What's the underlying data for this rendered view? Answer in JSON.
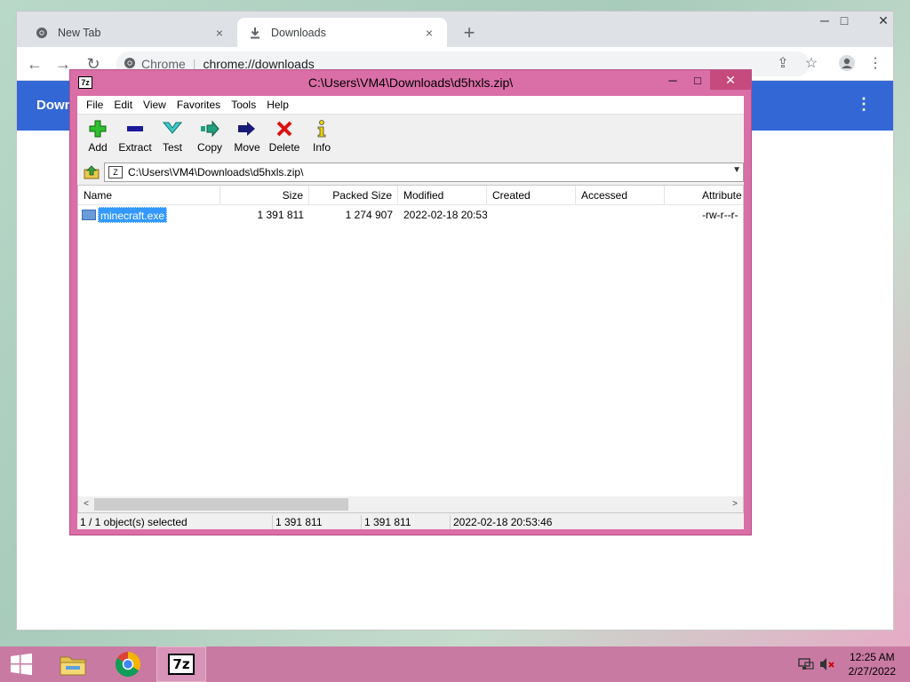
{
  "chrome": {
    "tabs": [
      {
        "label": "New Tab",
        "icon": "chrome-icon",
        "close": "×"
      },
      {
        "label": "Downloads",
        "icon": "download-icon",
        "close": "×"
      }
    ],
    "new_tab": "+",
    "window_controls": {
      "minimize": "─",
      "maximize": "□",
      "close": "✕"
    },
    "omnibox": {
      "origin": "Chrome",
      "separator": "|",
      "url": "chrome://downloads"
    },
    "page": {
      "title": "Down",
      "menu": "⋮"
    }
  },
  "zip": {
    "title": "C:\\Users\\VM4\\Downloads\\d5hxls.zip\\",
    "app_icon": "7z",
    "controls": {
      "minimize": "─",
      "maximize": "□",
      "close": "✕"
    },
    "menu": [
      "File",
      "Edit",
      "View",
      "Favorites",
      "Tools",
      "Help"
    ],
    "toolbar": [
      {
        "label": "Add",
        "icon": "add-icon",
        "color": "#22aa22"
      },
      {
        "label": "Extract",
        "icon": "extract-icon",
        "color": "#1a1a9a"
      },
      {
        "label": "Test",
        "icon": "test-icon",
        "color": "#20b0b0"
      },
      {
        "label": "Copy",
        "icon": "copy-icon",
        "color": "#189070"
      },
      {
        "label": "Move",
        "icon": "move-icon",
        "color": "#1a1a7a"
      },
      {
        "label": "Delete",
        "icon": "delete-icon",
        "color": "#dd1111"
      },
      {
        "label": "Info",
        "icon": "info-icon",
        "color": "#d8c400"
      }
    ],
    "address": "C:\\Users\\VM4\\Downloads\\d5hxls.zip\\",
    "address_icon": "Z",
    "columns": [
      "Name",
      "Size",
      "Packed Size",
      "Modified",
      "Created",
      "Accessed",
      "Attribute"
    ],
    "rows": [
      {
        "name": "minecraft.exe",
        "size": "1 391 811",
        "packed": "1 274 907",
        "modified": "2022-02-18 20:53",
        "created": "",
        "accessed": "",
        "attributes": "-rw-r--r-"
      }
    ],
    "scroll": {
      "left": "<",
      "right": ">"
    },
    "status": {
      "selection": "1 / 1 object(s) selected",
      "size": "1 391 811",
      "packed": "1 391 811",
      "modified": "2022-02-18 20:53:46"
    }
  },
  "taskbar": {
    "apps": [
      "windows-start-icon",
      "file-explorer-icon",
      "chrome-icon",
      "7zip-icon"
    ],
    "app_7z_label": "7z",
    "clock": {
      "time": "12:25 AM",
      "date": "2/27/2022"
    }
  }
}
